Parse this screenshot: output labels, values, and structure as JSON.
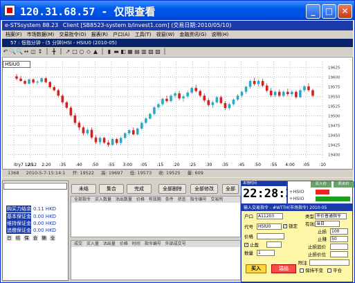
{
  "window": {
    "title": "120.31.68.57 - 仅限查看",
    "minimize_glyph": "_",
    "maximize_glyph": "□",
    "close_glyph": "✕"
  },
  "menubar": {
    "app": "e-STSsystem 88.23",
    "client": "Client [SB8523-system b/invest1.com] (交易日期:2010/05/10)"
  },
  "menu": [
    "档案(F)",
    "市场数据(M)",
    "交易指令(O)",
    "报表(R)",
    "户口(A)",
    "工具(T)",
    "视窗(W)",
    "金融资讯(G)",
    "说明(H)"
  ],
  "chart_window_title": "57 : 恒指分钟 - (5 分钟)HSI - HSIU0 (2010-05)",
  "toolbar_icons": [
    "↶",
    "🔍",
    "🔍",
    "↔",
    "◫",
    "↕",
    "│",
    "╋",
    "│",
    "↗",
    "□",
    "○",
    "◇",
    "▲",
    "│",
    "▮",
    "▬",
    "◧",
    "▦",
    "▤",
    "▥",
    "▧",
    "▨",
    "│"
  ],
  "symbol": "HSIU0",
  "chart_data": {
    "type": "candlestick",
    "time_labels": [
      "itry7 12:12",
      ":25",
      "2:20",
      ":35",
      ":40",
      ":50",
      ":55",
      "3:00",
      ":05",
      ":15",
      ":20",
      ":25",
      ":30",
      ":35",
      ":45",
      ":50",
      ":55",
      "4:00",
      ":05",
      ":10"
    ],
    "price_labels": [
      "19625",
      "19600",
      "19575",
      "19550",
      "19525",
      "19500",
      "19475",
      "19450",
      "19425",
      "19400"
    ],
    "y_range": [
      19390,
      19640
    ],
    "candles": [
      [
        19602,
        19608,
        19592,
        19596
      ],
      [
        19596,
        19603,
        19588,
        19590
      ],
      [
        19590,
        19594,
        19580,
        19583
      ],
      [
        19583,
        19596,
        19581,
        19594
      ],
      [
        19594,
        19597,
        19583,
        19586
      ],
      [
        19586,
        19592,
        19580,
        19588
      ],
      [
        19588,
        19599,
        19585,
        19597
      ],
      [
        19597,
        19600,
        19584,
        19587
      ],
      [
        19587,
        19590,
        19570,
        19574
      ],
      [
        19574,
        19579,
        19563,
        19566
      ],
      [
        19566,
        19570,
        19548,
        19552
      ],
      [
        19552,
        19556,
        19530,
        19535
      ],
      [
        19535,
        19538,
        19518,
        19521
      ],
      [
        19521,
        19526,
        19497,
        19501
      ],
      [
        19501,
        19507,
        19478,
        19482
      ],
      [
        19482,
        19487,
        19463,
        19470
      ],
      [
        19470,
        19473,
        19450,
        19455
      ],
      [
        19455,
        19468,
        19451,
        19464
      ],
      [
        19464,
        19470,
        19440,
        19444
      ],
      [
        19444,
        19450,
        19428,
        19432
      ],
      [
        19432,
        19447,
        19426,
        19443
      ],
      [
        19443,
        19446,
        19428,
        19431
      ],
      [
        19431,
        19437,
        19420,
        19425
      ],
      [
        19425,
        19444,
        19422,
        19440
      ],
      [
        19440,
        19443,
        19425,
        19430
      ],
      [
        19430,
        19447,
        19424,
        19443
      ],
      [
        19443,
        19458,
        19440,
        19455
      ],
      [
        19455,
        19466,
        19450,
        19463
      ],
      [
        19463,
        19470,
        19450,
        19452
      ],
      [
        19452,
        19470,
        19450,
        19467
      ],
      [
        19467,
        19486,
        19463,
        19482
      ],
      [
        19482,
        19497,
        19478,
        19493
      ],
      [
        19493,
        19508,
        19490,
        19505
      ],
      [
        19505,
        19525,
        19501,
        19522
      ],
      [
        19522,
        19534,
        19517,
        19530
      ],
      [
        19530,
        19547,
        19526,
        19544
      ],
      [
        19544,
        19552,
        19534,
        19538
      ],
      [
        19538,
        19556,
        19535,
        19552
      ],
      [
        19552,
        19563,
        19546,
        19558
      ],
      [
        19558,
        19564,
        19540,
        19545
      ],
      [
        19545,
        19555,
        19536,
        19550
      ],
      [
        19550,
        19565,
        19546,
        19560
      ],
      [
        19560,
        19575,
        19556,
        19572
      ],
      [
        19572,
        19580,
        19560,
        19564
      ],
      [
        19564,
        19568,
        19548,
        19552
      ],
      [
        19552,
        19558,
        19535,
        19540
      ],
      [
        19540,
        19546,
        19524,
        19528
      ],
      [
        19528,
        19540,
        19520,
        19535
      ],
      [
        19535,
        19551,
        19531,
        19548
      ],
      [
        19548,
        19552,
        19530,
        19533
      ],
      [
        19533,
        19538,
        19515,
        19520
      ],
      [
        19520,
        19534,
        19515,
        19530
      ],
      [
        19530,
        19545,
        19526,
        19542
      ],
      [
        19542,
        19556,
        19538,
        19552
      ],
      [
        19552,
        19565,
        19548,
        19562
      ],
      [
        19562,
        19578,
        19557,
        19575
      ],
      [
        19575,
        19594,
        19570,
        19590
      ],
      [
        19590,
        19598,
        19578,
        19582
      ],
      [
        19582,
        19594,
        19576,
        19590
      ],
      [
        19590,
        19596,
        19574,
        19578
      ],
      [
        19578,
        19584,
        19560,
        19565
      ],
      [
        19565,
        19572,
        19548,
        19553
      ],
      [
        19553,
        19566,
        19548,
        19562
      ],
      [
        19562,
        19568,
        19548,
        19552
      ],
      [
        19552,
        19566,
        19548,
        19562
      ],
      [
        19562,
        19570,
        19551,
        19556
      ],
      [
        19556,
        19566,
        19550,
        19562
      ],
      [
        19562,
        19566,
        19544,
        19548
      ],
      [
        19548,
        19570,
        19546,
        19566
      ],
      [
        19566,
        19580,
        19561,
        19576
      ],
      [
        19576,
        19584,
        19562,
        19566
      ],
      [
        19566,
        19570,
        19548,
        19552
      ]
    ],
    "grid": true
  },
  "statusline": [
    "1368",
    "2010-5-7-15:14:1",
    "开: 19522",
    "高: 19697",
    "低: 19573",
    "收: 19525",
    "量: 609"
  ],
  "account": {
    "combo": "",
    "rows": [
      {
        "label": "购买力结余",
        "value": "0.11 HKD"
      },
      {
        "label": "基本保证金",
        "value": "0.00 HKD"
      },
      {
        "label": "维持保证金",
        "value": "0.00 HKD"
      },
      {
        "label": "追缴保证金",
        "value": "0.00 HKD"
      },
      {
        "label": "追缴水平",
        "value": ""
      }
    ],
    "tabs": [
      "日",
      "结",
      "保",
      "合",
      "确",
      "全"
    ]
  },
  "mid_buttons": [
    "未结",
    "集合",
    "完成",
    "全部删除",
    "全部修改",
    "全部"
  ],
  "order_columns": [
    "全部指令",
    "买入数量",
    "沽出数量",
    "价格",
    "有效期",
    "条件",
    "状态",
    "指令编号",
    "交易所"
  ],
  "fill_columns": [
    "成交",
    "买入量",
    "沽出量",
    "价格",
    "时间",
    "指令编号",
    "外部成交号"
  ],
  "clock": {
    "title": "本地时间",
    "time": "22:28:31"
  },
  "quote": {
    "tabs": [
      "",
      "买入价",
      "卖出价"
    ],
    "rows": [
      "+HSIO",
      "+HSIO"
    ]
  },
  "order_panel": {
    "title": "输入交易指令 - #WTTH(市场指令) 2010-05",
    "account_label": "户口",
    "account_value": "A11203",
    "type_label": "类型",
    "type_value": "市价普通指令",
    "symbol_label": "代号",
    "symbol_value": "HSIU0",
    "validity_label": "有效期",
    "validity_value": "当日",
    "price_label": "价格",
    "stop_loss_label": "止损",
    "stop_loss_value": "100",
    "take_profit_label": "止赚",
    "take_profit_value": "50",
    "trailing_label": "止损追价",
    "trailing_value": "",
    "stop_level_label": "止损价位",
    "quantity_label": "数量",
    "quantity_value": "1",
    "checkbox_label": "锁定",
    "conditional_label": "止盈",
    "remark_label": "附注",
    "buy_label": "买入",
    "sell_label": "沽出",
    "keep_label": "保持不变",
    "cover_label": "平仓"
  }
}
